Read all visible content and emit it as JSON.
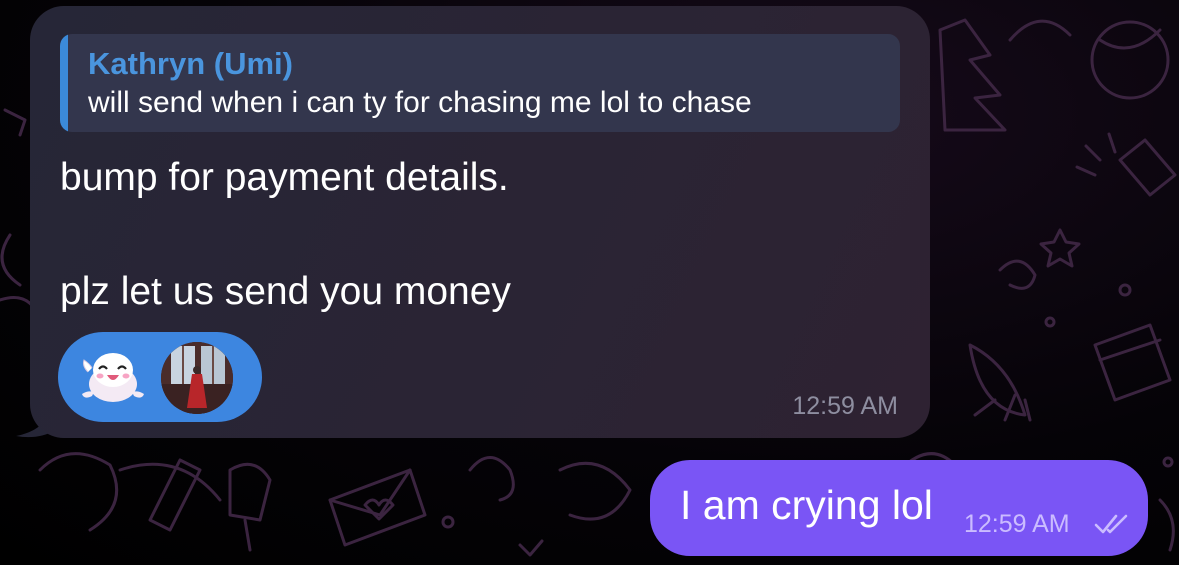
{
  "incoming_message": {
    "reply_to": {
      "author": "Kathryn (Umi)",
      "text": "will send when i can ty for chasing me lol to chase"
    },
    "body_line_1": "bump for payment details.",
    "body_line_2": "plz let us send you money",
    "reactions": [
      {
        "icon": "seal-sticker-icon"
      },
      {
        "icon": "avatar"
      }
    ],
    "time": "12:59 AM"
  },
  "outgoing_message": {
    "text": "I am crying lol",
    "time": "12:59 AM",
    "status_icon": "double-check-icon"
  },
  "colors": {
    "incoming_bubble": "#2a2434",
    "reply_accent": "#3b8ad9",
    "reply_name": "#4a95de",
    "reaction_pill": "#3d86e0",
    "outgoing_bubble": "#7a55f5"
  }
}
